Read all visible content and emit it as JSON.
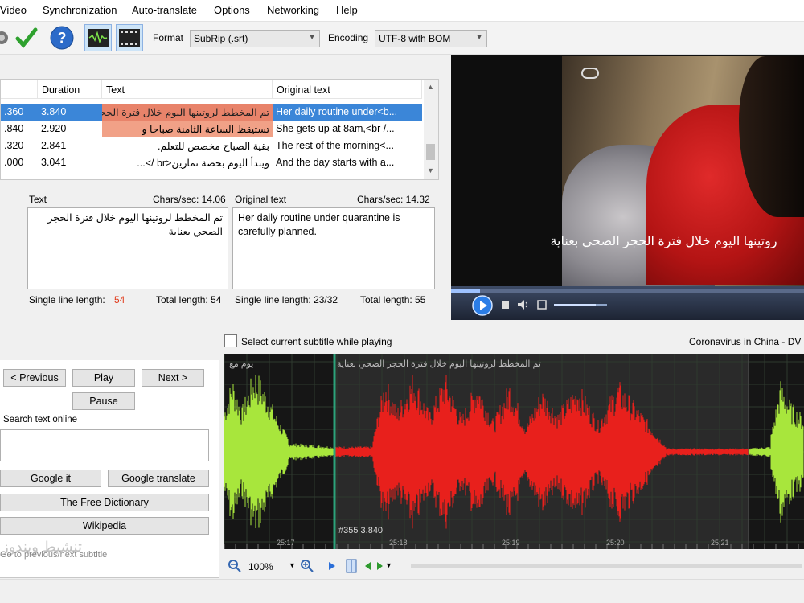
{
  "menu": [
    "Video",
    "Synchronization",
    "Auto-translate",
    "Options",
    "Networking",
    "Help"
  ],
  "toolbar": {
    "format_label": "Format",
    "format_value": "SubRip (.srt)",
    "encoding_label": "Encoding",
    "encoding_value": "UTF-8 with BOM"
  },
  "grid": {
    "headers": [
      "Duration",
      "Text",
      "Original text"
    ],
    "rows": [
      {
        "start": ".360",
        "duration": "3.840",
        "text": "تم المخطط لروتينها اليوم خلال فترة الحجر الصحي بعناية",
        "original": "Her daily routine under<b..."
      },
      {
        "start": ".840",
        "duration": "2.920",
        "text": "تستيقظ الساعة الثامنة صباحا و",
        "original": "She gets up at 8am,<br /..."
      },
      {
        "start": ".320",
        "duration": "2.841",
        "text": "بقية الصباح مخصص للتعلم.",
        "original": "The rest of the morning<..."
      },
      {
        "start": ".000",
        "duration": "3.041",
        "text": "ويبدأ اليوم بحصة تمارين<br />...",
        "original": "And the day starts with a..."
      }
    ]
  },
  "editor": {
    "text_label": "Text",
    "text_cps": "Chars/sec: 14.06",
    "text_value": "تم المخطط لروتينها اليوم خلال فترة الحجر الصحي بعناية",
    "original_label": "Original text",
    "original_cps": "Chars/sec: 14.32",
    "original_value": "Her daily routine under quarantine is carefully planned.",
    "text_single_label": "Single line length:",
    "text_single_value": "54",
    "text_total": "Total length: 54",
    "orig_single": "Single line length: 23/32",
    "orig_total": "Total length: 55"
  },
  "video": {
    "subtitle": "روتينها اليوم خلال فترة الحجر الصحي بعناية"
  },
  "waveform": {
    "select_label": "Select current subtitle while playing",
    "title": "Coronavirus in China - DV",
    "sub_left": "يوم مع",
    "sub_main": "تم المخطط لروتينها اليوم خلال فترة الحجر الصحي بعناية",
    "info": "#355  3.840",
    "ticks": [
      "25:17",
      "25:18",
      "25:19",
      "25:20",
      "25:21"
    ],
    "zoom": "100%"
  },
  "left_panel": {
    "previous": "< Previous",
    "play": "Play",
    "next": "Next >",
    "pause": "Pause",
    "search_label": "Search text online",
    "google_it": "Google it",
    "google_translate": "Google translate",
    "free_dictionary": "The Free Dictionary",
    "wikipedia": "Wikipedia",
    "hint": "Go to previous/next subtitle"
  },
  "watermark": "تنشيط ويندوز"
}
